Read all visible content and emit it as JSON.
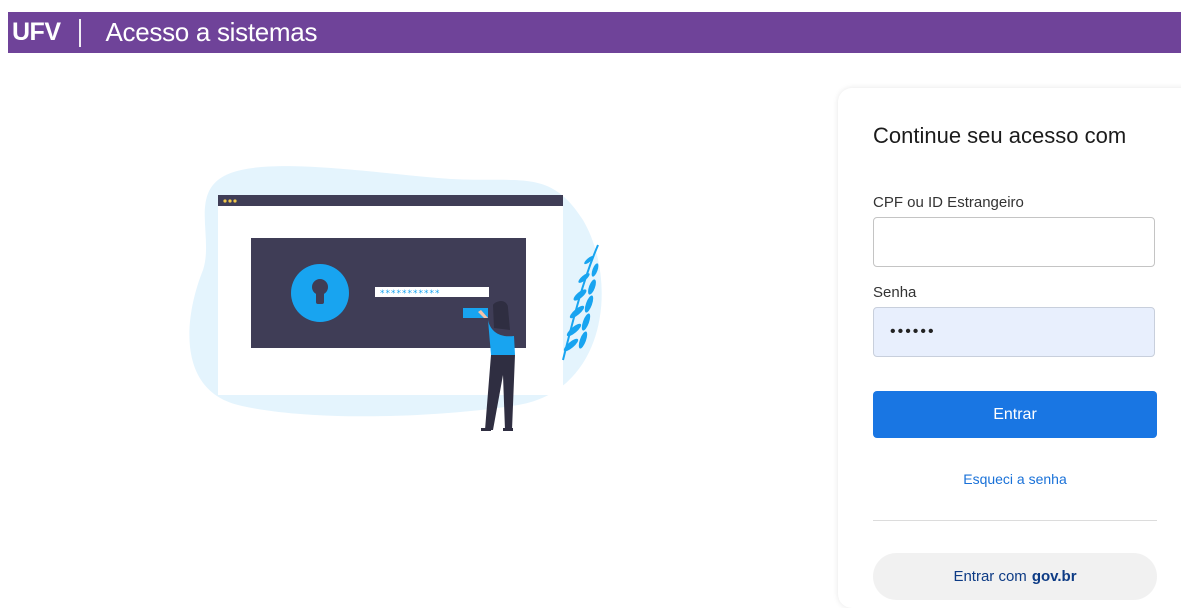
{
  "header": {
    "logo": "UFV",
    "title": "Acesso a sistemas"
  },
  "colors": {
    "brand": "#6f4399",
    "primary_button": "#1976e3",
    "illustration_accent": "#18a4f0"
  },
  "illustration": {
    "password_mask": "***********"
  },
  "login": {
    "heading": "Continue seu acesso com",
    "cpf_label": "CPF ou ID Estrangeiro",
    "cpf_value": "",
    "password_label": "Senha",
    "password_value": "••••••",
    "submit_label": "Entrar",
    "forgot_label": "Esqueci a senha",
    "govbr_prefix": "Entrar com",
    "govbr_brand": "gov.br"
  }
}
